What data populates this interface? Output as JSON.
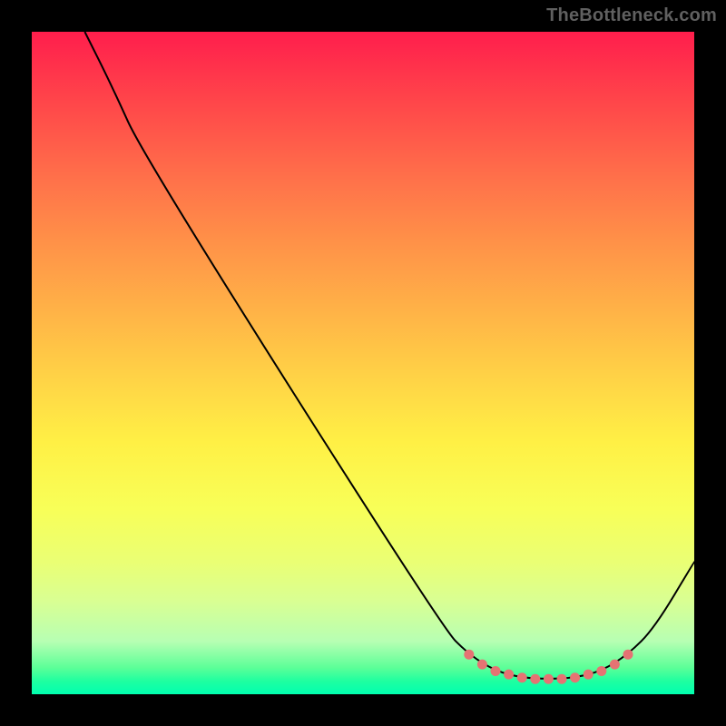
{
  "watermark": "TheBottleneck.com",
  "chart_data": {
    "type": "line",
    "title": "",
    "xlabel": "",
    "ylabel": "",
    "xlim": [
      0,
      100
    ],
    "ylim": [
      0,
      100
    ],
    "curve": [
      {
        "x": 8,
        "y": 100
      },
      {
        "x": 12,
        "y": 92
      },
      {
        "x": 17,
        "y": 81
      },
      {
        "x": 62,
        "y": 10
      },
      {
        "x": 66,
        "y": 6
      },
      {
        "x": 70,
        "y": 3.5
      },
      {
        "x": 74,
        "y": 2.5
      },
      {
        "x": 78,
        "y": 2.3
      },
      {
        "x": 82,
        "y": 2.5
      },
      {
        "x": 86,
        "y": 3.5
      },
      {
        "x": 90,
        "y": 6
      },
      {
        "x": 94,
        "y": 10
      },
      {
        "x": 100,
        "y": 20
      }
    ],
    "dots": [
      {
        "x": 66,
        "y": 6
      },
      {
        "x": 68,
        "y": 4.5
      },
      {
        "x": 70,
        "y": 3.5
      },
      {
        "x": 72,
        "y": 3
      },
      {
        "x": 74,
        "y": 2.5
      },
      {
        "x": 76,
        "y": 2.3
      },
      {
        "x": 78,
        "y": 2.3
      },
      {
        "x": 80,
        "y": 2.3
      },
      {
        "x": 82,
        "y": 2.5
      },
      {
        "x": 84,
        "y": 3
      },
      {
        "x": 86,
        "y": 3.5
      },
      {
        "x": 88,
        "y": 4.5
      },
      {
        "x": 90,
        "y": 6
      }
    ]
  }
}
